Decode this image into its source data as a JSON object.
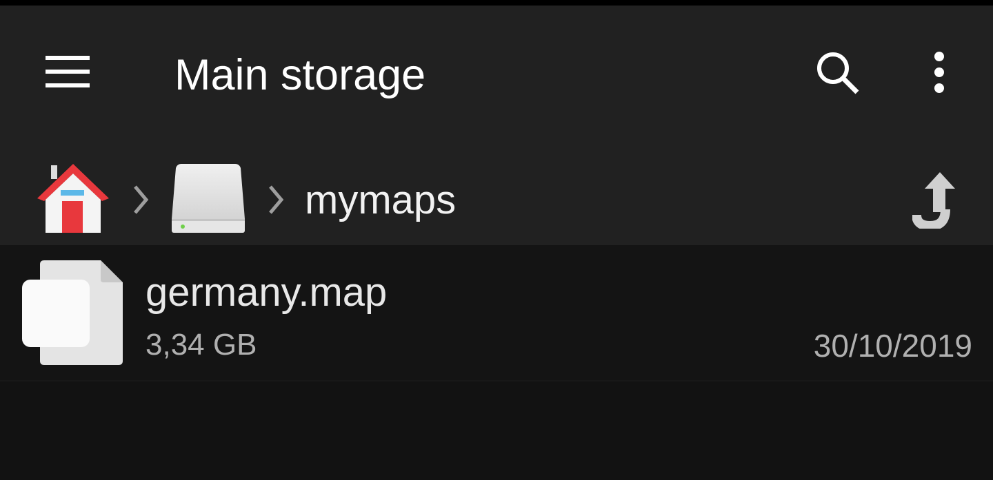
{
  "toolbar": {
    "title": "Main storage",
    "menu_icon": "hamburger-menu-icon",
    "search_icon": "search-icon",
    "overflow_icon": "more-vertical-icon"
  },
  "breadcrumb": {
    "items": [
      {
        "type": "home",
        "icon": "home-icon"
      },
      {
        "type": "storage",
        "icon": "hard-drive-icon"
      },
      {
        "type": "folder",
        "label": "mymaps"
      }
    ],
    "separator_icon": "chevron-right-icon",
    "up_icon": "navigate-up-icon"
  },
  "files": [
    {
      "name": "germany.map",
      "size": "3,34 GB",
      "date": "30/10/2019",
      "icon": "file-icon"
    }
  ],
  "colors": {
    "toolbar_bg": "#212121",
    "list_bg": "#141414",
    "home_roof": "#e8383d",
    "home_window": "#5bb8e8"
  }
}
